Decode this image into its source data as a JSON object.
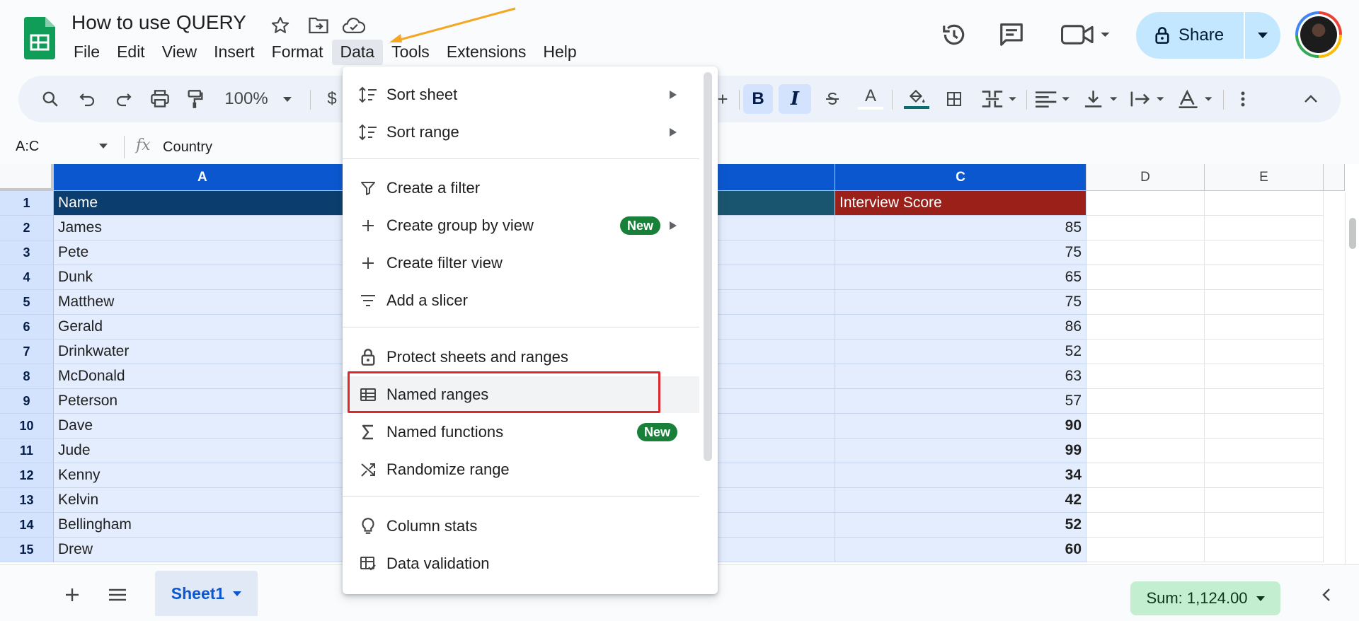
{
  "app": {
    "doc_title": "How to use QUERY",
    "menu": [
      "File",
      "Edit",
      "View",
      "Insert",
      "Format",
      "Data",
      "Tools",
      "Extensions",
      "Help"
    ],
    "share_label": "Share"
  },
  "toolbar": {
    "zoom": "100%",
    "currency": "$"
  },
  "formula_bar": {
    "name_box": "A:C",
    "fx": "fx",
    "value": "Country"
  },
  "grid": {
    "columns": [
      "A",
      "C",
      "D",
      "E"
    ],
    "rows": [
      {
        "n": "1",
        "a": "Name",
        "c": "Interview Score"
      },
      {
        "n": "2",
        "a": "James",
        "c": "85"
      },
      {
        "n": "3",
        "a": "Pete",
        "c": "75"
      },
      {
        "n": "4",
        "a": "Dunk",
        "c": "65"
      },
      {
        "n": "5",
        "a": "Matthew",
        "c": "75"
      },
      {
        "n": "6",
        "a": "Gerald",
        "c": "86"
      },
      {
        "n": "7",
        "a": "Drinkwater",
        "c": "52"
      },
      {
        "n": "8",
        "a": "McDonald",
        "c": "63"
      },
      {
        "n": "9",
        "a": "Peterson",
        "c": "57"
      },
      {
        "n": "10",
        "a": "Dave",
        "c": "90"
      },
      {
        "n": "11",
        "a": "Jude",
        "c": "99"
      },
      {
        "n": "12",
        "a": "Kenny",
        "c": "34"
      },
      {
        "n": "13",
        "a": "Kelvin",
        "c": "42"
      },
      {
        "n": "14",
        "a": "Bellingham",
        "c": "52"
      },
      {
        "n": "15",
        "a": "Drew",
        "c": "60"
      }
    ]
  },
  "data_menu": {
    "items": [
      {
        "label": "Sort sheet",
        "icon": "sort-icon"
      },
      {
        "label": "Sort range",
        "icon": "sort-icon"
      },
      {
        "label": "Create a filter",
        "icon": "filter-icon"
      },
      {
        "label": "Create group by view",
        "icon": "plus-icon",
        "badge": "New"
      },
      {
        "label": "Create filter view",
        "icon": "plus-icon"
      },
      {
        "label": "Add a slicer",
        "icon": "slicer-icon"
      },
      {
        "label": "Protect sheets and ranges",
        "icon": "lock-icon"
      },
      {
        "label": "Named ranges",
        "icon": "named-range-icon"
      },
      {
        "label": "Named functions",
        "icon": "sigma-icon",
        "badge": "New"
      },
      {
        "label": "Randomize range",
        "icon": "shuffle-icon"
      },
      {
        "label": "Column stats",
        "icon": "lightbulb-icon"
      },
      {
        "label": "Data validation",
        "icon": "validation-icon"
      }
    ]
  },
  "bottom": {
    "sheet_name": "Sheet1",
    "sum": "Sum: 1,124.00"
  },
  "colors": {
    "accent": "#0b57d0",
    "highlight": "#e0252b",
    "badge": "#188038",
    "arrow": "#f5a623"
  }
}
